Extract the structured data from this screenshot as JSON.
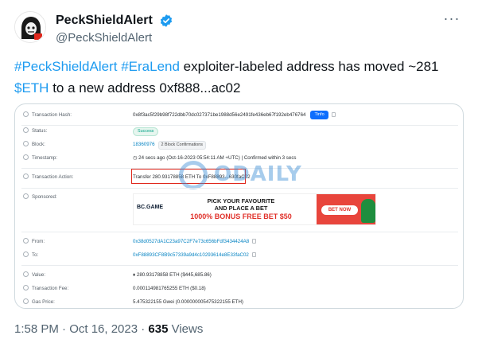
{
  "account": {
    "display_name": "PeckShieldAlert",
    "handle": "@PeckShieldAlert",
    "more_label": "···",
    "verified_color": "#1d9bf0"
  },
  "tweet": {
    "hashtag1": "#PeckShieldAlert",
    "hashtag2": "#EraLend",
    "text1": " exploiter-labeled address has moved ~281",
    "cashtag": "$ETH",
    "text2": " to a new address 0xf888...ac02"
  },
  "tx": {
    "hash_label": "Transaction Hash:",
    "hash_value": "0x8f3ac5f29b98f722dbb70dc027371be1988d56e2491fe436eb67f192eb476764",
    "tinfo_label": "Tinfo",
    "status_label": "Status:",
    "status_value": "Success",
    "block_label": "Block:",
    "block_value": "18360976",
    "block_conf": "2 Block Confirmations",
    "timestamp_label": "Timestamp:",
    "timestamp_value": "24 secs ago (Oct-16-2023 05:54:11 AM +UTC)",
    "timestamp_conf": "Confirmed within 3 secs",
    "action_label": "Transaction Action:",
    "action_value": "Transfer 280.93178858 ETH To 0xF88893...630faC02",
    "sponsored_label": "Sponsored:",
    "from_label": "From:",
    "from_value": "0x38d0527dA1C23a97C2F7e73c656bFdf3434424A8",
    "to_label": "To:",
    "to_value": "0xF88893CF8B9c57339a9d4c10293614e8E33faC02",
    "value_label": "Value:",
    "value_value": "280.93178858 ETH ($445,685.86)",
    "fee_label": "Transaction Fee:",
    "fee_value": "0.000114981765255 ETH ($0.18)",
    "gas_label": "Gas Price:",
    "gas_value": "5.475322155 Gwei (0.000000005475322155 ETH)"
  },
  "ad": {
    "brand": "BC.GAME",
    "line1": "PICK YOUR FAVOURITE",
    "line2": "AND PLACE A BET",
    "line3": "1000% BONUS FREE BET $50",
    "button": "BET NOW",
    "accent": "#e8453c"
  },
  "watermark": {
    "text": "ODAILY"
  },
  "footer": {
    "time": "1:58 PM · Oct 16, 2023 · ",
    "views_count": "635",
    "views_label": " Views"
  }
}
